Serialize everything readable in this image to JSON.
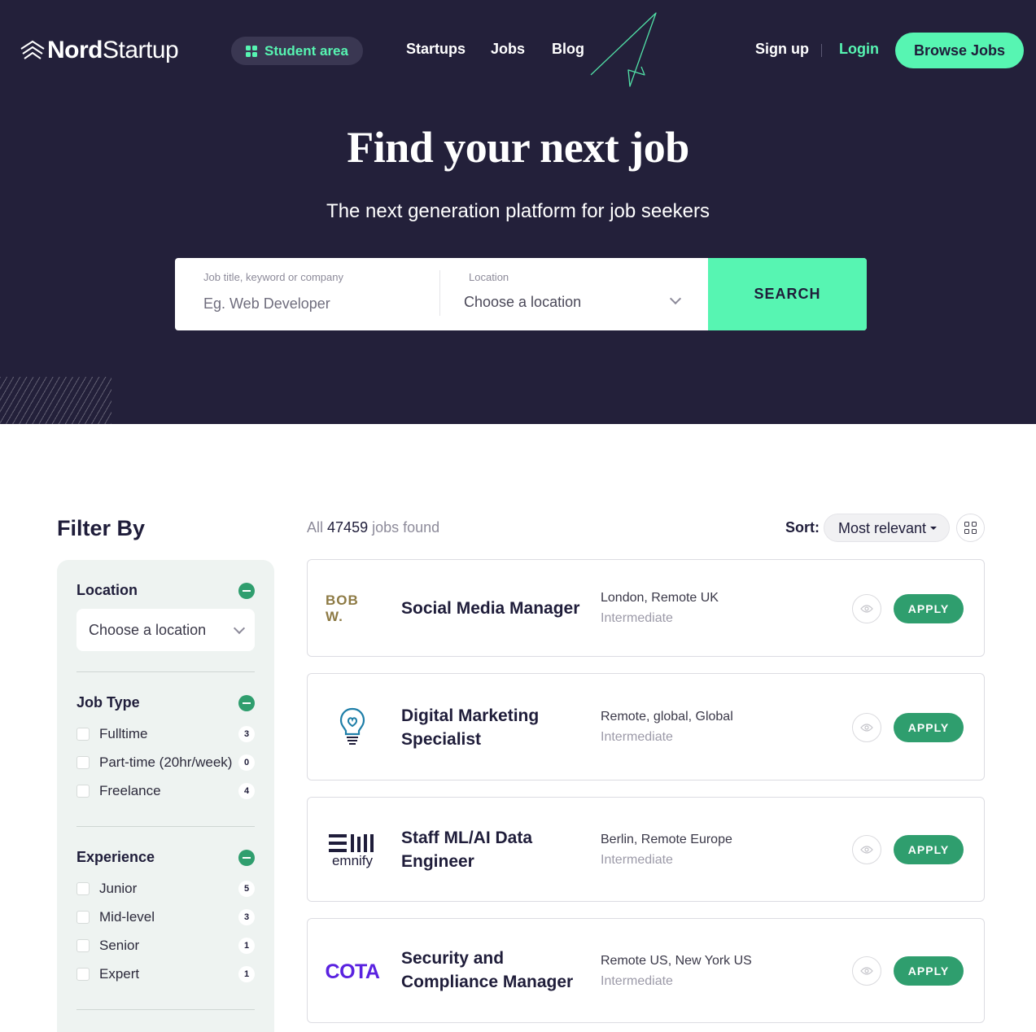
{
  "header": {
    "logo": {
      "brand_bold": "Nord",
      "brand_light": "Startup"
    },
    "student_area": "Student area",
    "nav": [
      "Startups",
      "Jobs",
      "Blog"
    ],
    "sign_up": "Sign up",
    "login": "Login",
    "browse_jobs": "Browse Jobs",
    "colors": {
      "background": "#23203a",
      "accent": "#57f5b2"
    }
  },
  "hero": {
    "title": "Find your next job",
    "subtitle": "The next generation platform for job seekers"
  },
  "search": {
    "keyword_label": "Job title, keyword or company",
    "keyword_placeholder": "Eg. Web Developer",
    "location_label": "Location",
    "location_value": "Choose a location",
    "button": "SEARCH"
  },
  "filters": {
    "title": "Filter By",
    "location": {
      "title": "Location",
      "value": "Choose a location"
    },
    "job_type": {
      "title": "Job Type",
      "options": [
        {
          "label": "Fulltime",
          "count": "3"
        },
        {
          "label": "Part-time (20hr/week)",
          "count": "0"
        },
        {
          "label": "Freelance",
          "count": "4"
        }
      ]
    },
    "experience": {
      "title": "Experience",
      "options": [
        {
          "label": "Junior",
          "count": "5"
        },
        {
          "label": "Mid-level",
          "count": "3"
        },
        {
          "label": "Senior",
          "count": "1"
        },
        {
          "label": "Expert",
          "count": "1"
        }
      ]
    }
  },
  "results": {
    "prefix": "All",
    "count": "47459",
    "suffix": "jobs found",
    "sort_label": "Sort:",
    "sort_value": "Most relevant",
    "apply_label": "APPLY",
    "jobs": [
      {
        "company_logo": "BOB W.",
        "title": "Social Media Manager",
        "location": "London, Remote UK",
        "level": "Intermediate"
      },
      {
        "company_logo": "lightbulb-logo",
        "title": "Digital Marketing Specialist",
        "location": "Remote, global, Global",
        "level": "Intermediate"
      },
      {
        "company_logo": "emnify",
        "title": "Staff ML/AI Data Engineer",
        "location": "Berlin, Remote Europe",
        "level": "Intermediate"
      },
      {
        "company_logo": "COTA",
        "title": "Security and Compliance Manager",
        "location": "Remote US, New York US",
        "level": "Intermediate"
      }
    ]
  }
}
